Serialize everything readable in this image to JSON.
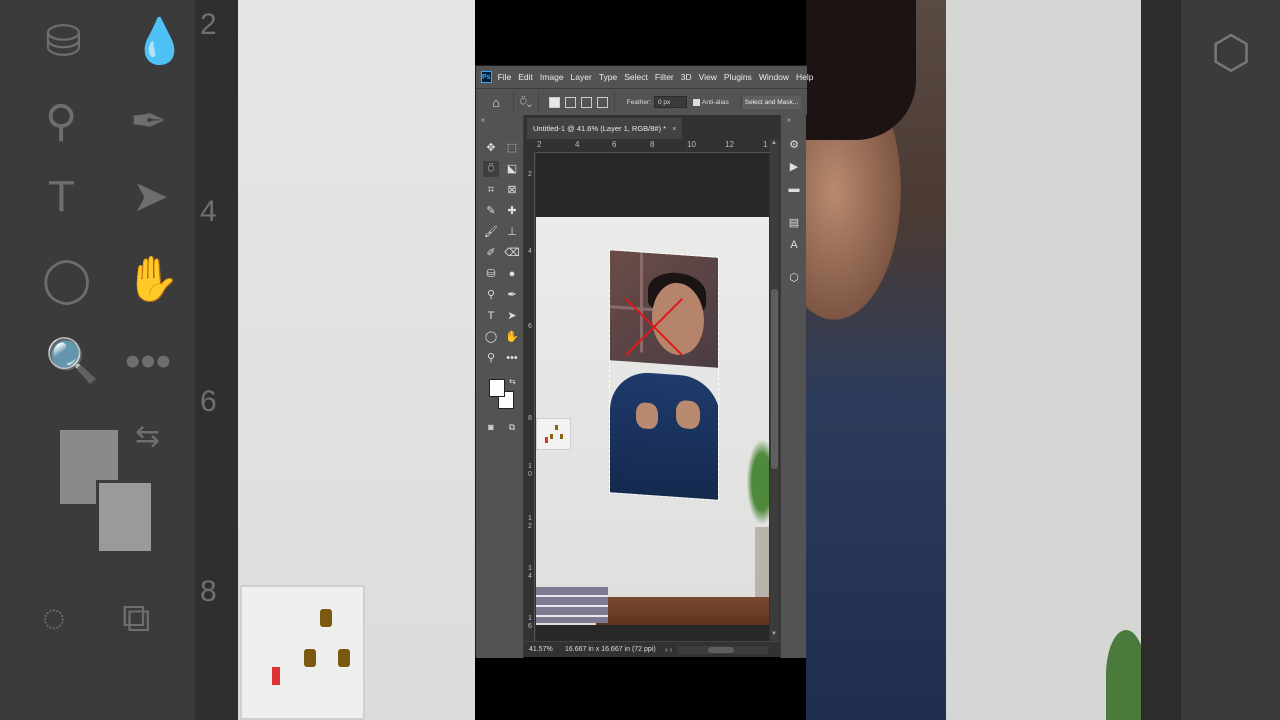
{
  "app": {
    "logo": "Ps",
    "menu": [
      "File",
      "Edit",
      "Image",
      "Layer",
      "Type",
      "Select",
      "Filter",
      "3D",
      "View",
      "Plugins",
      "Window",
      "Help"
    ]
  },
  "options_bar": {
    "feather_label": "Feather:",
    "feather_value": "0 px",
    "anti_alias_label": "Anti-alias",
    "select_and_mask_label": "Select and Mask..."
  },
  "document": {
    "tab_title": "Untitled-1 @ 41.6% (Layer 1, RGB/8#) *",
    "tab_close": "×"
  },
  "rulers": {
    "horizontal": [
      "2",
      "4",
      "6",
      "8",
      "10",
      "12",
      "1"
    ],
    "vertical": [
      "2",
      "4",
      "6",
      "8",
      "1 0",
      "1 2",
      "1 4",
      "1 6"
    ]
  },
  "status": {
    "zoom": "41.57%",
    "doc_info": "16.667 in x 16.667 in (72 ppi)"
  },
  "background": {
    "left_ruler_numbers": [
      "2",
      "4",
      "6",
      "8"
    ]
  },
  "icons": {
    "left_tools": [
      "move-icon",
      "marquee-icon",
      "polygonal-lasso-icon",
      "object-select-icon",
      "crop-icon",
      "frame-icon",
      "eyedropper-icon",
      "healing-brush-icon",
      "brush-icon",
      "clone-stamp-icon",
      "history-brush-icon",
      "eraser-icon",
      "paint-bucket-icon",
      "blur-icon",
      "dodge-icon",
      "pen-icon",
      "type-icon",
      "path-select-icon",
      "ellipse-icon",
      "hand-icon",
      "zoom-icon",
      "more-tools-icon",
      "quick-mask-icon",
      "screen-mode-icon"
    ],
    "right_panels": [
      "properties-icon",
      "actions-icon",
      "comments-icon",
      "libraries-icon",
      "character-icon",
      "3d-icon"
    ]
  },
  "colors": {
    "foreground": "#ffffff",
    "background": "#ffffff",
    "selection_marker": "#e01818",
    "ui_panel": "#535353"
  }
}
